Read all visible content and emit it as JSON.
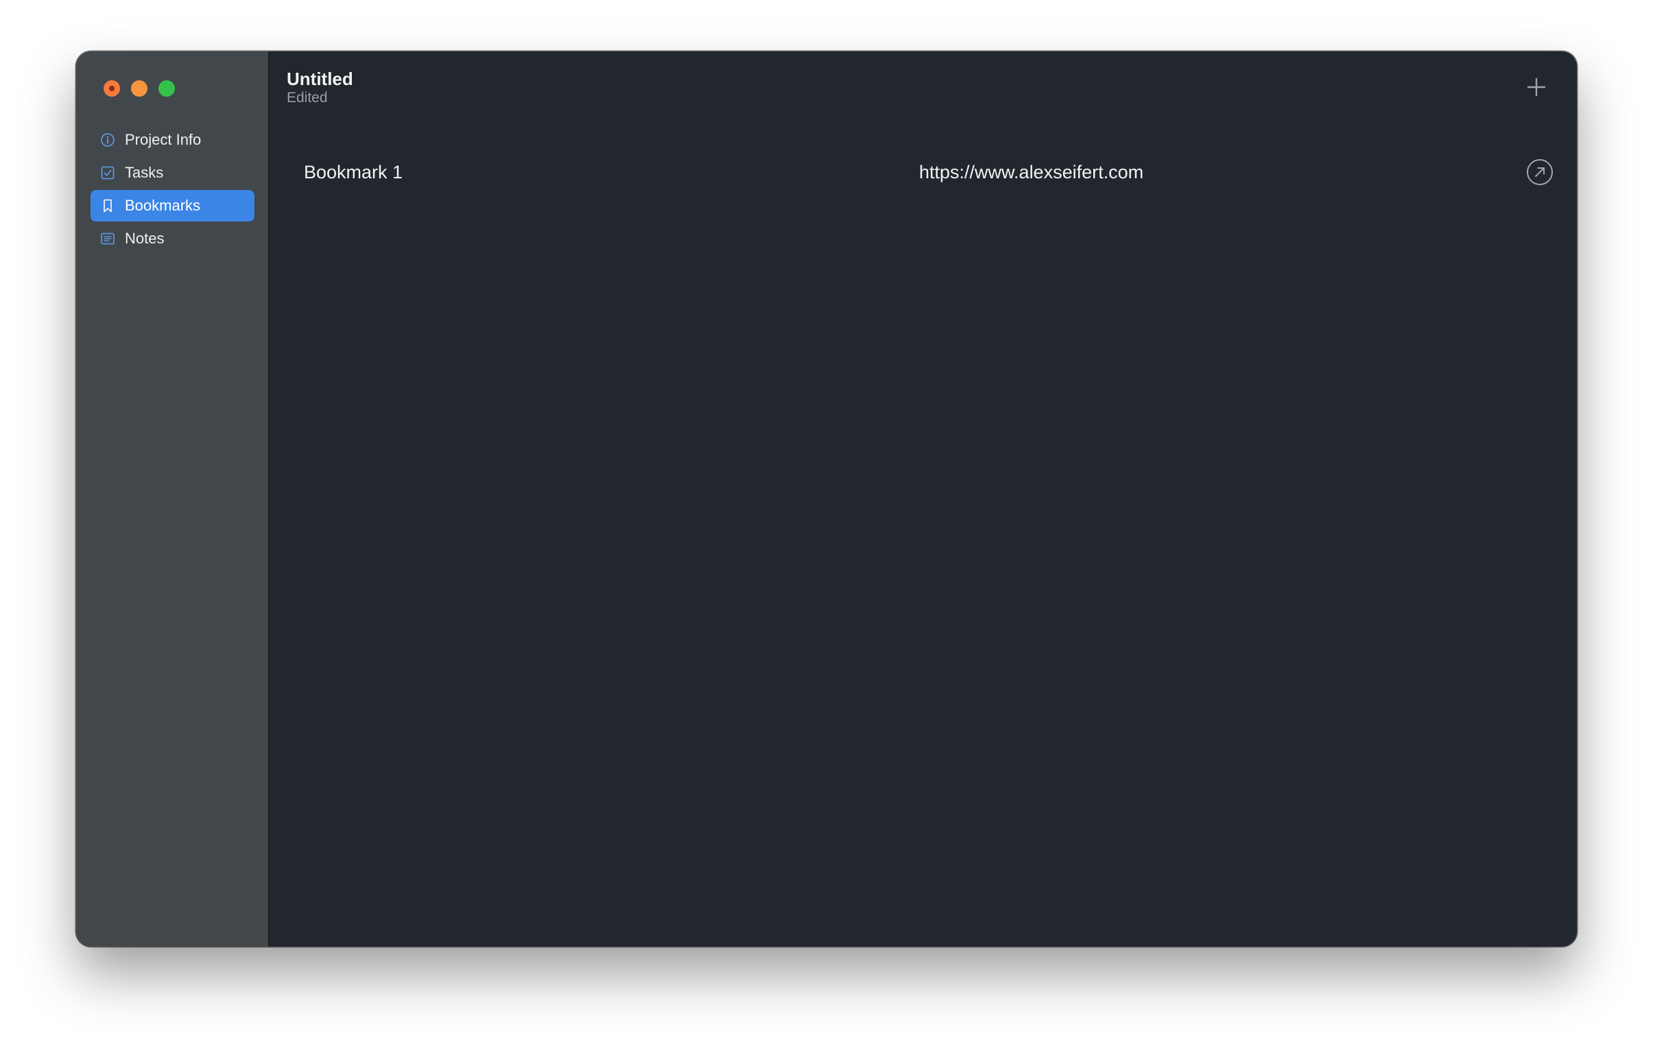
{
  "window": {
    "traffic_lights": [
      "close",
      "minimize",
      "zoom"
    ]
  },
  "sidebar": {
    "items": [
      {
        "label": "Project Info",
        "icon": "info-circle-icon",
        "selected": false
      },
      {
        "label": "Tasks",
        "icon": "checkbox-icon",
        "selected": false
      },
      {
        "label": "Bookmarks",
        "icon": "bookmark-icon",
        "selected": true
      },
      {
        "label": "Notes",
        "icon": "notes-icon",
        "selected": false
      }
    ]
  },
  "header": {
    "title": "Untitled",
    "subtitle": "Edited",
    "add_icon": "plus-icon"
  },
  "bookmarks": [
    {
      "name": "Bookmark 1",
      "url": "https://www.alexseifert.com",
      "open_icon": "arrow-up-right-circle-icon"
    }
  ],
  "colors": {
    "accent": "#3a85e6",
    "sidebar_bg": "#42474b",
    "content_bg": "#22262d",
    "icon_blue": "#5aa0f0"
  }
}
